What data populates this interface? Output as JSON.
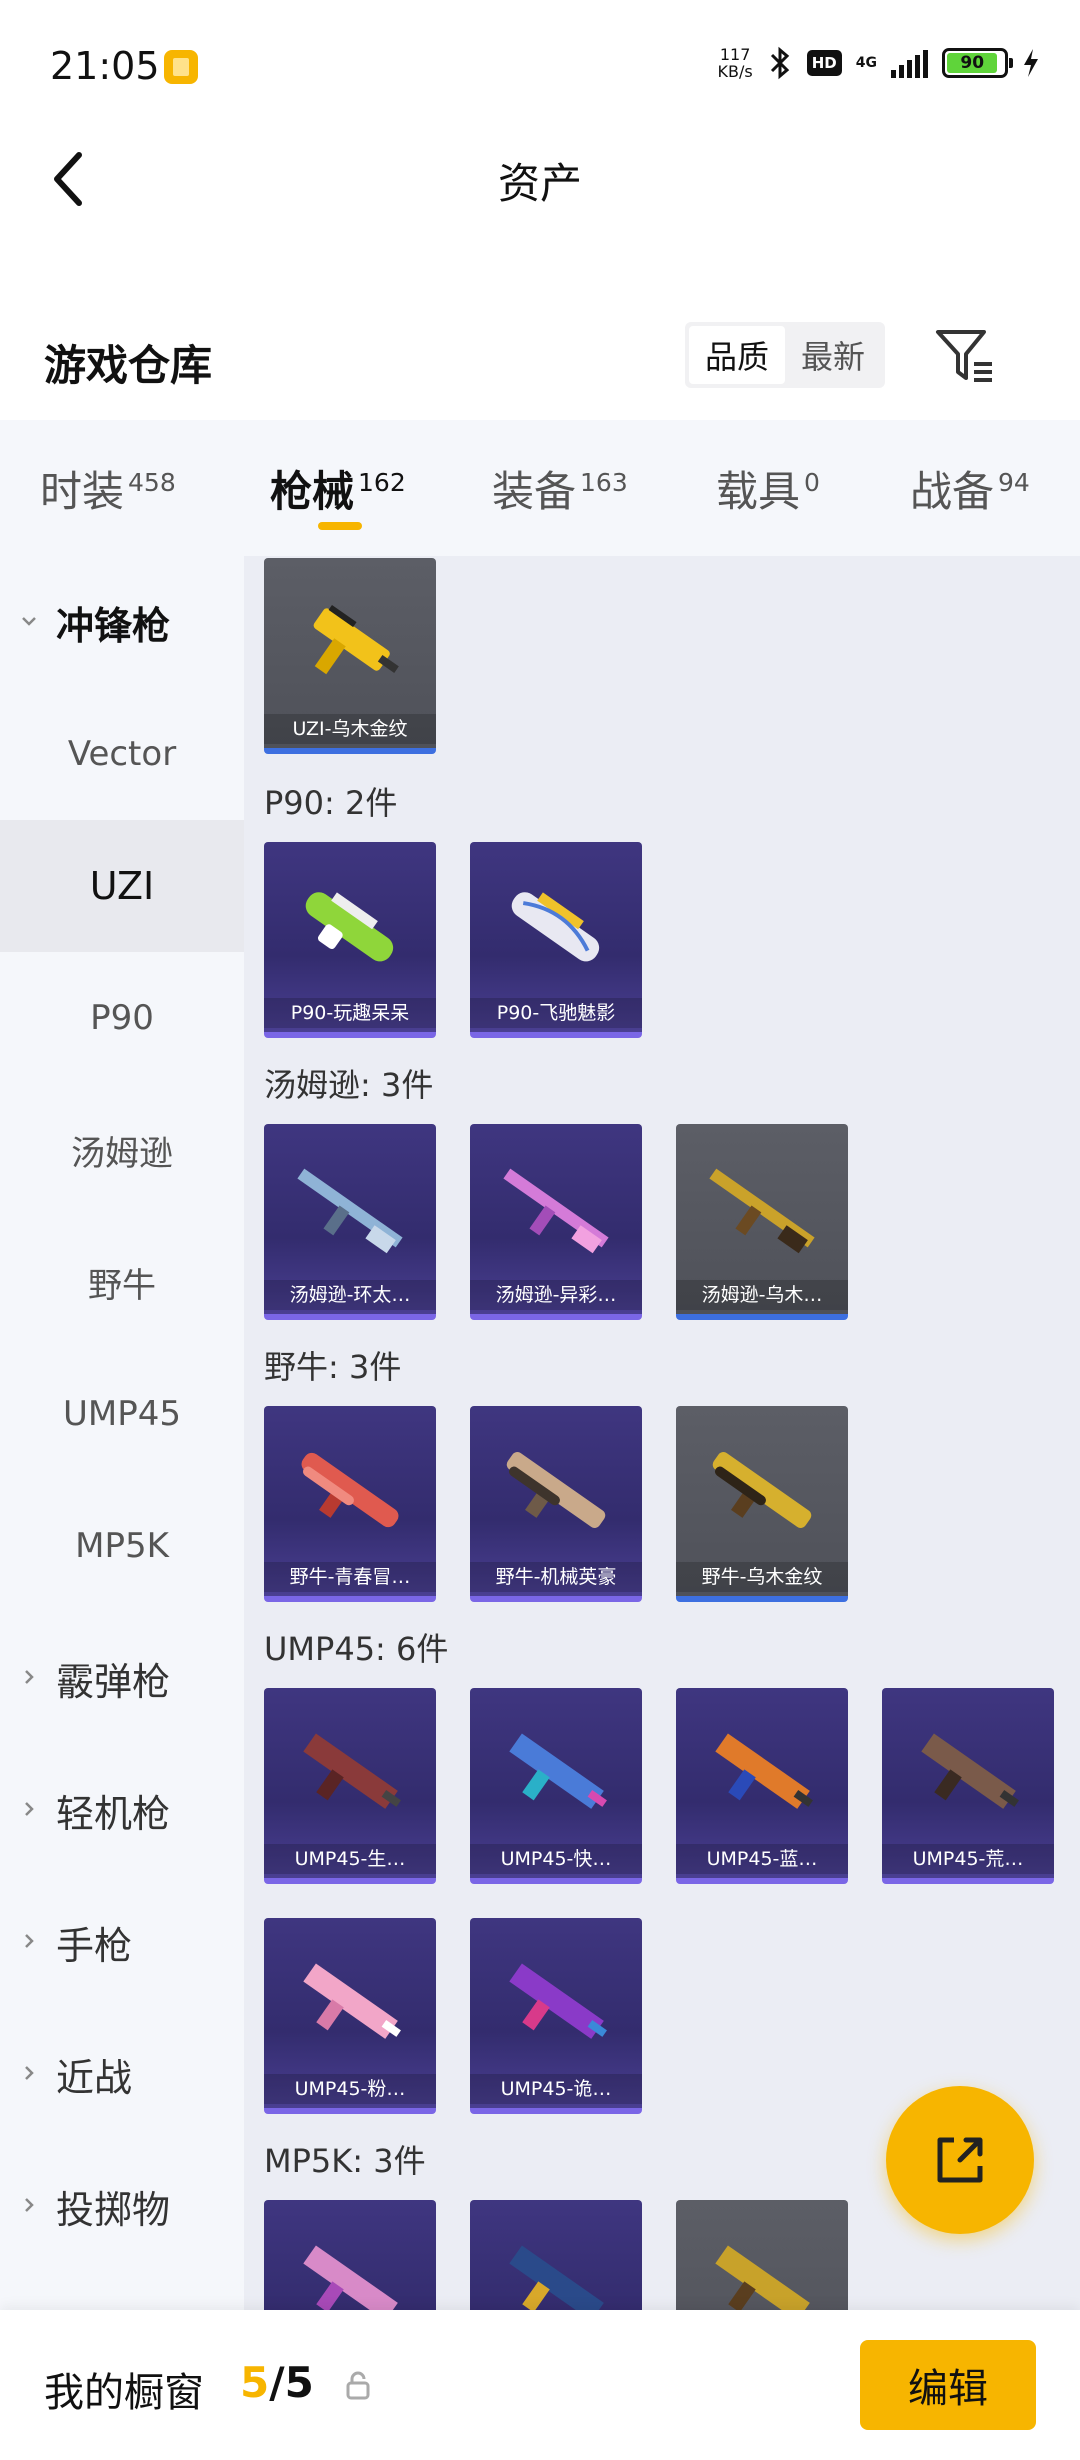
{
  "status_bar": {
    "time": "21:05",
    "net_speed_value": "117",
    "net_speed_unit": "KB/s",
    "hd": "HD",
    "network": "4G",
    "battery": "90",
    "icons": [
      "app-icon",
      "bluetooth-icon",
      "hd-icon",
      "signal-icon",
      "battery-icon",
      "charging-icon"
    ]
  },
  "header": {
    "back_icon": "back-arrow-icon",
    "title": "资产"
  },
  "section": {
    "title": "游戏仓库",
    "sort_options": [
      "品质",
      "最新"
    ],
    "sort_selected": "品质",
    "filter_icon": "filter-icon"
  },
  "category_tabs": [
    {
      "label": "时装",
      "count": "458"
    },
    {
      "label": "枪械",
      "count": "162",
      "active": true
    },
    {
      "label": "装备",
      "count": "163"
    },
    {
      "label": "载具",
      "count": "0"
    },
    {
      "label": "战备",
      "count": "94"
    }
  ],
  "sidebar": [
    {
      "label": "冲锋枪",
      "type": "group",
      "expanded": true
    },
    {
      "label": "Vector",
      "type": "item"
    },
    {
      "label": "UZI",
      "type": "item",
      "selected": true
    },
    {
      "label": "P90",
      "type": "item"
    },
    {
      "label": "汤姆逊",
      "type": "item"
    },
    {
      "label": "野牛",
      "type": "item"
    },
    {
      "label": "UMP45",
      "type": "item"
    },
    {
      "label": "MP5K",
      "type": "item"
    },
    {
      "label": "霰弹枪",
      "type": "group"
    },
    {
      "label": "轻机枪",
      "type": "group"
    },
    {
      "label": "手枪",
      "type": "group"
    },
    {
      "label": "近战",
      "type": "group"
    },
    {
      "label": "投掷物",
      "type": "group"
    }
  ],
  "groups": {
    "uzi": {
      "items": [
        {
          "name": "UZI-乌木金纹",
          "rarity": "gray"
        }
      ]
    },
    "p90": {
      "title": "P90: 2件",
      "items": [
        {
          "name": "P90-玩趣呆呆",
          "rarity": "purple"
        },
        {
          "name": "P90-飞驰魅影",
          "rarity": "purple"
        }
      ]
    },
    "thompson": {
      "title": "汤姆逊: 3件",
      "items": [
        {
          "name": "汤姆逊-环太…",
          "rarity": "purple"
        },
        {
          "name": "汤姆逊-异彩…",
          "rarity": "purple"
        },
        {
          "name": "汤姆逊-乌木…",
          "rarity": "gray"
        }
      ]
    },
    "bizon": {
      "title": "野牛: 3件",
      "items": [
        {
          "name": "野牛-青春冒…",
          "rarity": "purple"
        },
        {
          "name": "野牛-机械英豪",
          "rarity": "purple"
        },
        {
          "name": "野牛-乌木金纹",
          "rarity": "gray"
        }
      ]
    },
    "ump45": {
      "title": "UMP45: 6件",
      "items": [
        {
          "name": "UMP45-生…",
          "rarity": "purple"
        },
        {
          "name": "UMP45-快…",
          "rarity": "purple"
        },
        {
          "name": "UMP45-蓝…",
          "rarity": "purple"
        },
        {
          "name": "UMP45-荒…",
          "rarity": "purple"
        },
        {
          "name": "UMP45-粉…",
          "rarity": "purple"
        },
        {
          "name": "UMP45-诡…",
          "rarity": "purple"
        }
      ]
    },
    "mp5k": {
      "title": "MP5K: 3件"
    }
  },
  "colors": {
    "accent": "#f7b500",
    "purple_card": "#3a3276",
    "gray_card": "#55575f",
    "panel_bg": "#ebedf4",
    "sidebar_bg": "#f5f7fb"
  },
  "fab_icon": "share-icon",
  "bottom_bar": {
    "label": "我的橱窗",
    "current": "5",
    "separator": "/",
    "total": "5",
    "lock_icon": "lock-icon",
    "edit_label": "编辑"
  }
}
